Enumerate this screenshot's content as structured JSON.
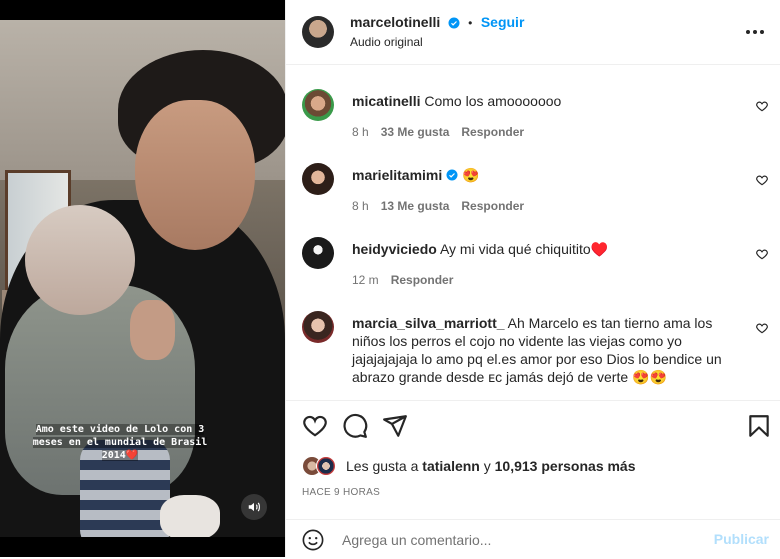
{
  "post": {
    "username": "marcelotinelli",
    "follow_label": "Seguir",
    "separator": "•",
    "audio": "Audio original",
    "video_caption": "Amo este video de Lolo con 3 meses en el mundial de Brasil 2014❤️"
  },
  "comments": [
    {
      "username": "micatinelli",
      "text": "Como los amooooooo",
      "time": "8 h",
      "likes": "33 Me gusta",
      "reply": "Responder",
      "verified": false
    },
    {
      "username": "marielitamimi",
      "text": "😍",
      "time": "8 h",
      "likes": "13 Me gusta",
      "reply": "Responder",
      "verified": true
    },
    {
      "username": "heidyviciedo",
      "text": "Ay mi vida qué chiquitito♥️",
      "time": "12 m",
      "likes": "",
      "reply": "Responder",
      "verified": false
    },
    {
      "username": "marcia_silva_marriott_",
      "text": "Ah Marcelo es tan tierno ama los niños los perros el cojo no vidente las viejas como yo jajajajajaja lo amo pq el.es amor por eso Dios lo bendice un abrazo grande desde ᴇᴄ jamás dejó de verte 😍😍",
      "time": "",
      "likes": "",
      "reply": "",
      "verified": false
    }
  ],
  "likes": {
    "prefix": "Les gusta a ",
    "user": "tatialenn",
    "connector": " y ",
    "count": "10,913 personas más"
  },
  "timestamp": "HACE 9 HORAS",
  "comment_box": {
    "placeholder": "Agrega un comentario...",
    "post_label": "Publicar"
  },
  "colors": {
    "accent": "#0095f6",
    "verified": "#0095f6",
    "post_disabled": "#b2dffc",
    "muted": "#737373"
  },
  "icons": {
    "header": [
      "verified-badge-icon",
      "more-options-icon"
    ],
    "actions": [
      "heart-icon",
      "comment-icon",
      "share-icon",
      "bookmark-icon"
    ],
    "media": [
      "audio-icon"
    ],
    "comment_box": [
      "emoji-icon"
    ]
  }
}
